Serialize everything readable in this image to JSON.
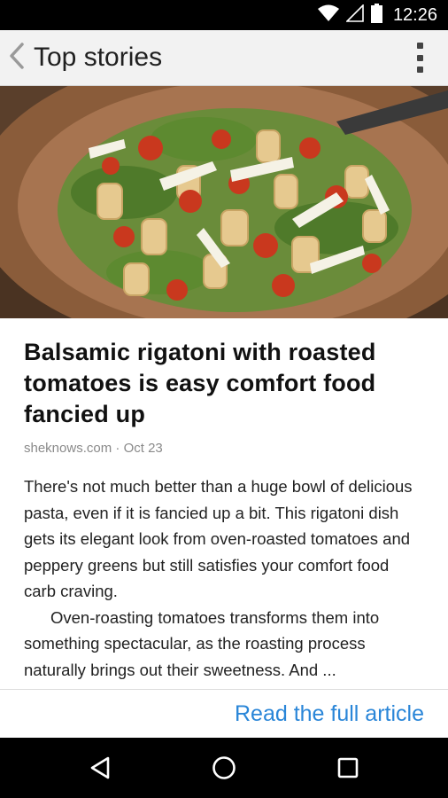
{
  "status_bar": {
    "time": "12:26",
    "icons": [
      "wifi-icon",
      "signal-icon",
      "battery-icon"
    ]
  },
  "app_bar": {
    "title": "Top stories",
    "back_icon": "chevron-left-icon",
    "menu_icon": "more-vert-icon"
  },
  "article": {
    "headline": "Balsamic rigatoni with roasted tomatoes is easy comfort food fancied up",
    "source": "sheknows.com",
    "separator": " · ",
    "date": "Oct 23",
    "paragraphs": [
      "There's not much better than a huge bowl of delicious pasta, even if it is fancied up a bit. This rigatoni dish gets its elegant look from oven-roasted tomatoes and peppery greens but still satisfies your comfort food carb craving.",
      "Oven-roasting tomatoes transforms them into something spectacular, as the roasting process naturally brings out their sweetness. And ..."
    ],
    "read_more_label": "Read the full article"
  },
  "nav_bar": {
    "buttons": [
      "back-triangle-icon",
      "home-circle-icon",
      "recents-square-icon"
    ]
  },
  "colors": {
    "link": "#2a86d8",
    "app_bar_bg": "#f2f2f2",
    "status_bar_bg": "#000000"
  }
}
